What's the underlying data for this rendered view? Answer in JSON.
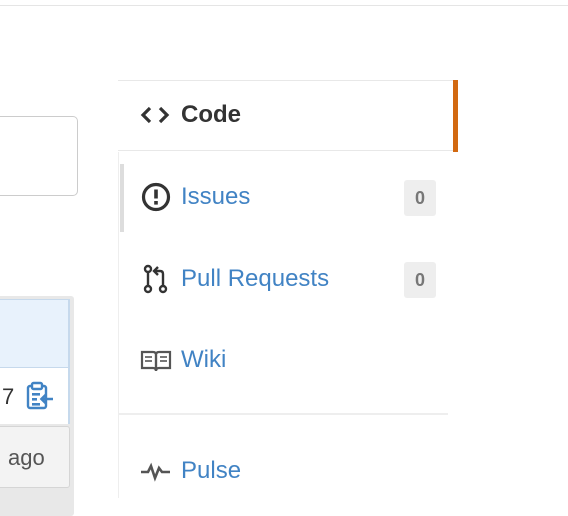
{
  "left": {
    "row_value": "7",
    "time_label": "ago"
  },
  "nav": {
    "items": [
      {
        "label": "Code",
        "icon": "code-icon",
        "active": true
      },
      {
        "label": "Issues",
        "icon": "issue-opened-icon",
        "counter": "0"
      },
      {
        "label": "Pull Requests",
        "icon": "git-pull-request-icon",
        "counter": "0"
      },
      {
        "label": "Wiki",
        "icon": "book-icon"
      },
      {
        "label": "Pulse",
        "icon": "pulse-icon"
      }
    ]
  },
  "colors": {
    "accent": "#d26911",
    "link": "#4183c4",
    "text": "#333333"
  }
}
